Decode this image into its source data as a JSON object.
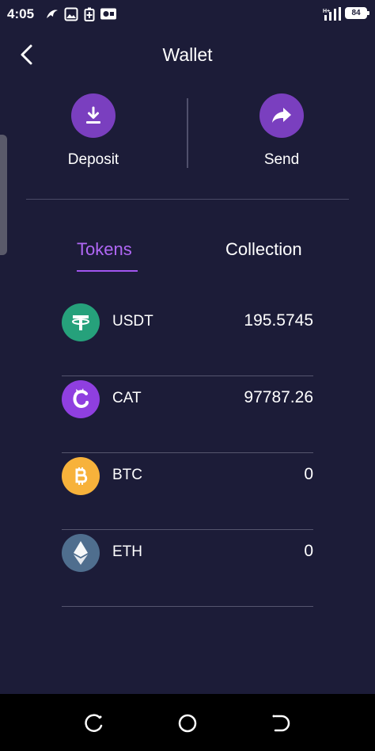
{
  "status_bar": {
    "time": "4:05",
    "battery": "84"
  },
  "header": {
    "title": "Wallet",
    "back_icon": "chevron-left-icon"
  },
  "actions": [
    {
      "label": "Deposit",
      "icon": "download-icon"
    },
    {
      "label": "Send",
      "icon": "share-arrow-icon"
    }
  ],
  "tabs": [
    {
      "label": "Tokens",
      "active": true
    },
    {
      "label": "Collection",
      "active": false
    }
  ],
  "tokens": [
    {
      "symbol": "USDT",
      "value": "195.5745",
      "icon": "tether-icon",
      "color": "#26a17b"
    },
    {
      "symbol": "CAT",
      "value": "97787.26",
      "icon": "cat-c-icon",
      "color": "#8f3fe0"
    },
    {
      "symbol": "BTC",
      "value": "0",
      "icon": "bitcoin-icon",
      "color": "#f7b23b"
    },
    {
      "symbol": "ETH",
      "value": "0",
      "icon": "ethereum-icon",
      "color": "#4f6e8e"
    }
  ],
  "colors": {
    "background": "#1c1c38",
    "accent": "#a155ef",
    "action_circle": "#7a3fbf"
  }
}
